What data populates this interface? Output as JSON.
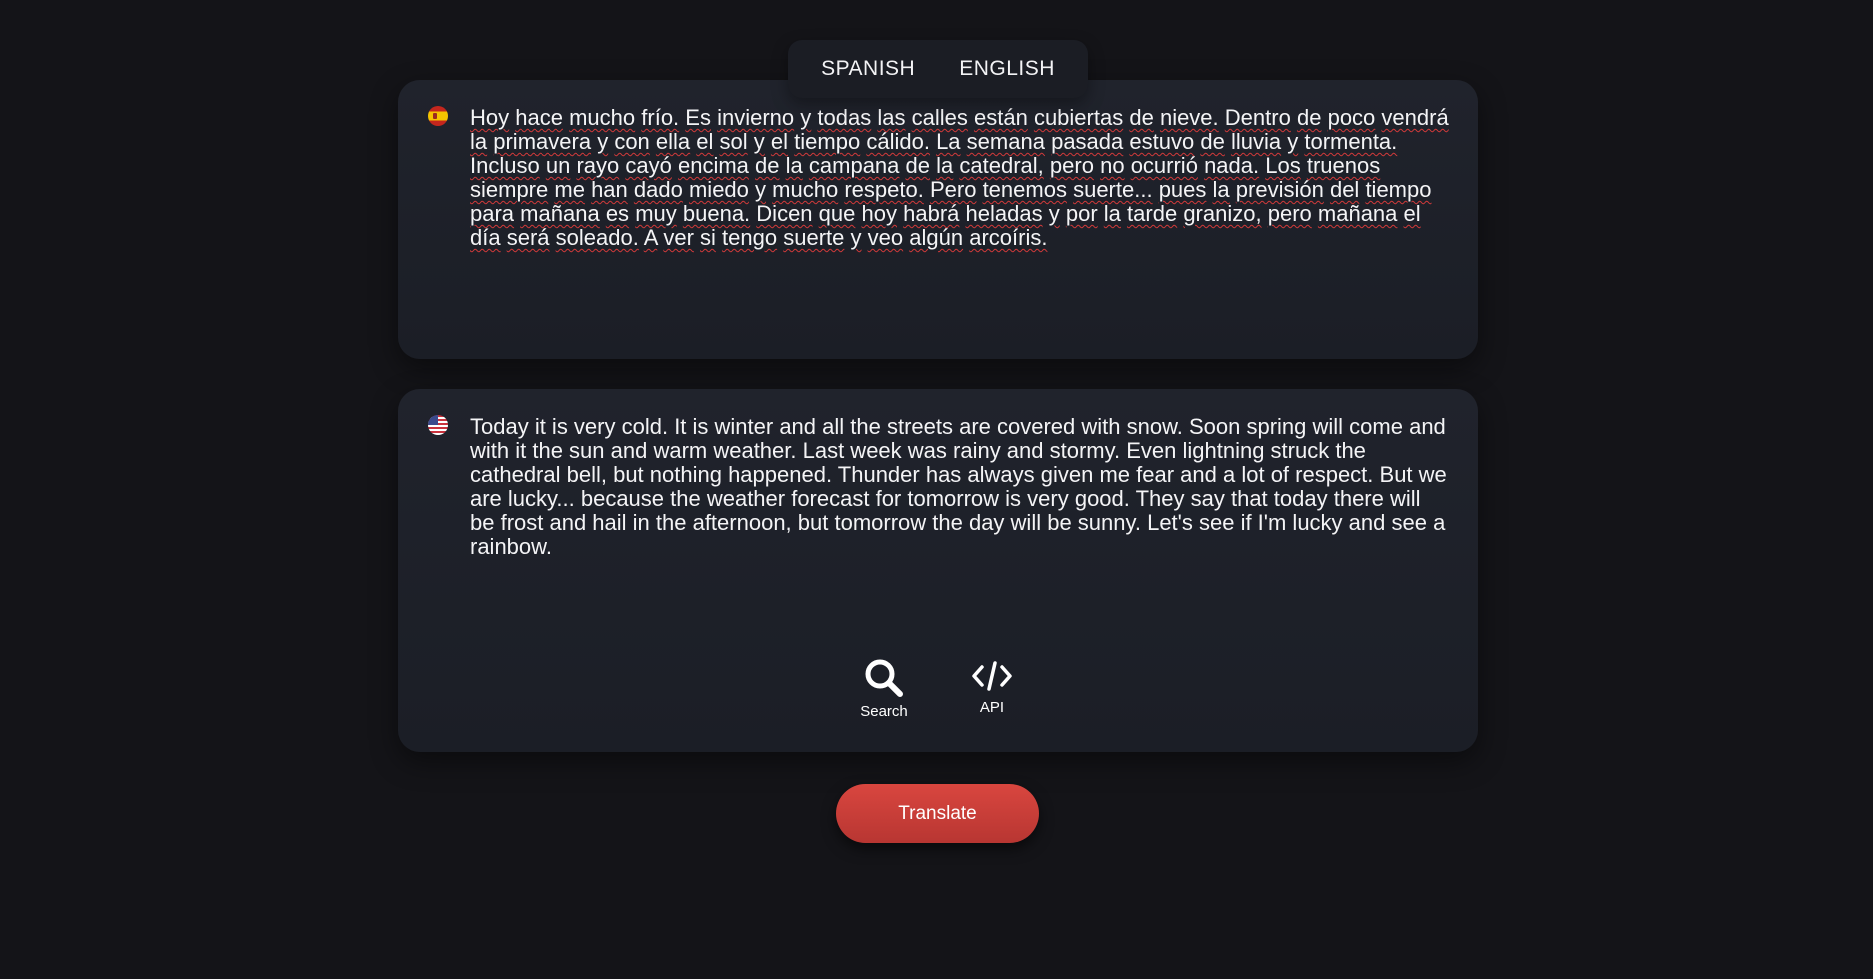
{
  "tabs": {
    "source": "SPANISH",
    "target": "ENGLISH"
  },
  "source": {
    "flag": "spain-flag-icon",
    "text": "Hoy hace mucho frío. Es invierno y todas las calles están cubiertas de nieve. Dentro de poco vendrá la primavera y con ella el sol y el tiempo cálido. La semana pasada estuvo de lluvia y tormenta. Incluso un rayo cayó encima de la campana de la catedral, pero no ocurrió nada. Los truenos siempre me han dado miedo y mucho respeto. Pero tenemos suerte... pues la previsión del tiempo para mañana es muy buena. Dicen que hoy habrá heladas y por la tarde granizo, pero mañana el día será soleado. A ver si tengo suerte y veo algún arcoíris."
  },
  "target": {
    "flag": "usa-flag-icon",
    "text": "Today it is very cold. It is winter and all the streets are covered with snow. Soon spring will come and with it the sun and warm weather. Last week was rainy and stormy. Even lightning struck the cathedral bell, but nothing happened. Thunder has always given me fear and a lot of respect. But we are lucky... because the weather forecast for tomorrow is very good. They say that today there will be frost and hail in the afternoon, but tomorrow the day will be sunny. Let's see if I'm lucky and see a rainbow."
  },
  "tools": [
    {
      "icon": "search-icon",
      "label": "Search"
    },
    {
      "icon": "code-icon",
      "label": "API"
    }
  ],
  "translate_label": "Translate",
  "colors": {
    "accent": "#d23f3a",
    "panel": "#20232c",
    "background": "#141418"
  }
}
